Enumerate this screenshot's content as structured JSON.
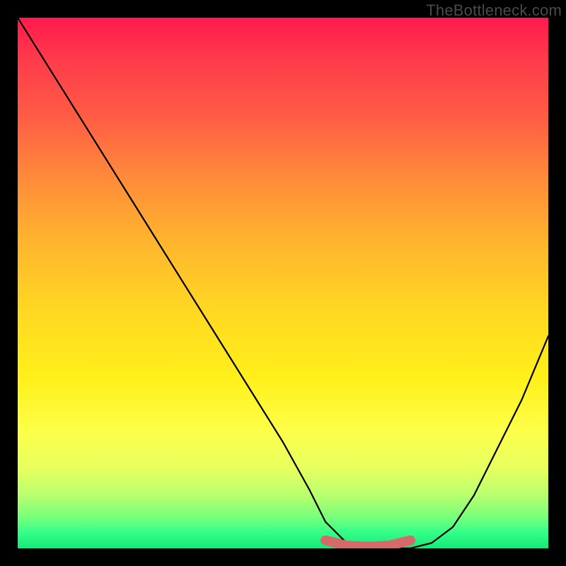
{
  "watermark": "TheBottleneck.com",
  "chart_data": {
    "type": "line",
    "title": "",
    "xlabel": "",
    "ylabel": "",
    "xlim": [
      0,
      100
    ],
    "ylim": [
      0,
      100
    ],
    "series": [
      {
        "name": "bottleneck-curve",
        "x": [
          0,
          5,
          10,
          15,
          20,
          25,
          30,
          35,
          40,
          45,
          50,
          55,
          58,
          62,
          66,
          70,
          74,
          78,
          82,
          86,
          90,
          95,
          100
        ],
        "y": [
          100,
          92,
          84,
          76,
          68,
          60,
          52,
          44,
          36,
          28,
          20,
          11,
          5,
          1,
          0,
          0,
          0,
          1,
          4,
          10,
          18,
          28,
          40
        ],
        "color": "#000000"
      },
      {
        "name": "highlight-segment",
        "x": [
          58,
          62,
          66,
          70,
          74
        ],
        "y": [
          1.5,
          0.5,
          0.3,
          0.5,
          1.5
        ],
        "color": "#d46a6a"
      }
    ]
  }
}
